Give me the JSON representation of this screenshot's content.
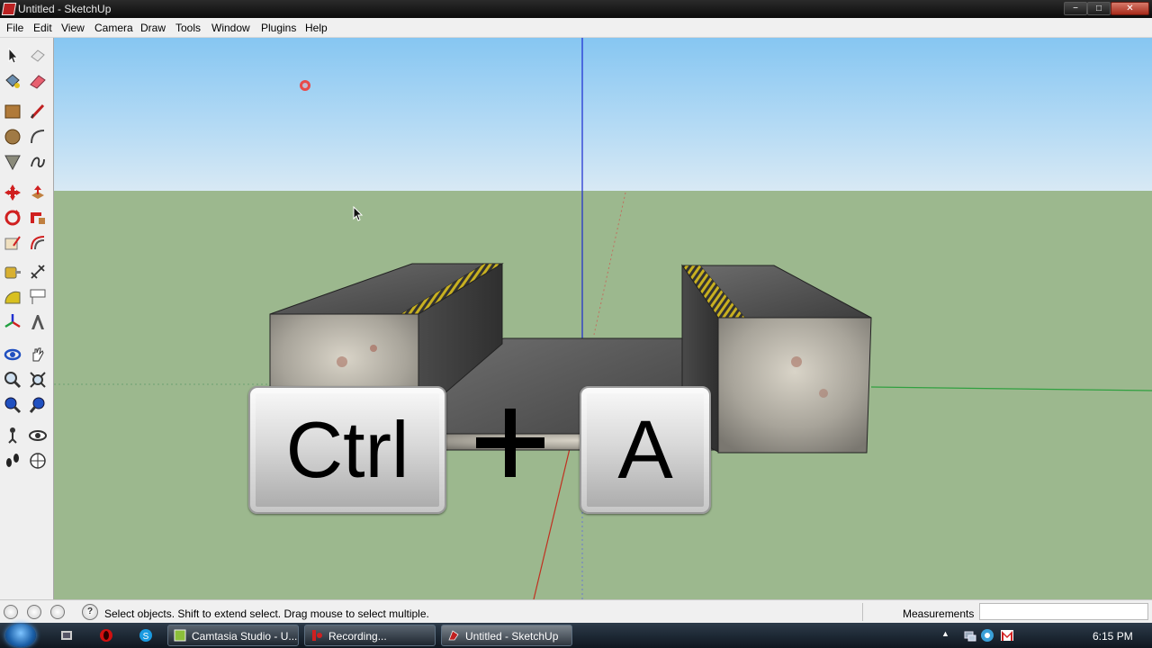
{
  "window": {
    "title": "Untitled - SketchUp",
    "controls": {
      "minimize": "−",
      "maximize": "□",
      "close": "✕"
    }
  },
  "menu": [
    "File",
    "Edit",
    "View",
    "Camera",
    "Draw",
    "Tools",
    "Window",
    "Plugins",
    "Help"
  ],
  "toolbar": {
    "tools": [
      "select-icon",
      "make-component-icon",
      "paint-bucket-icon",
      "eraser-icon",
      "rectangle-icon",
      "line-icon",
      "circle-icon",
      "arc-icon",
      "polygon-icon",
      "freehand-icon",
      "move-icon",
      "push-pull-icon",
      "rotate-icon",
      "follow-me-icon",
      "scale-icon",
      "offset-icon",
      "tape-measure-icon",
      "dimension-icon",
      "protractor-icon",
      "text-icon",
      "axes-icon",
      "3d-text-icon",
      "orbit-icon",
      "pan-icon",
      "zoom-icon",
      "zoom-extents-icon",
      "previous-view-icon",
      "next-view-icon",
      "position-camera-icon",
      "look-around-icon",
      "walk-icon",
      "section-plane-icon"
    ]
  },
  "overlay": {
    "key1": "Ctrl",
    "key2": "A"
  },
  "status": {
    "help_icon": "?",
    "text": "Select objects. Shift to extend select. Drag mouse to select multiple.",
    "measurements_label": "Measurements",
    "measurements_value": ""
  },
  "taskbar": {
    "items": [
      {
        "label": "Camtasia Studio - U...",
        "icon": "camtasia-icon"
      },
      {
        "label": "Recording...",
        "icon": "recording-icon"
      },
      {
        "label": "Untitled - SketchUp",
        "icon": "sketchup-icon"
      }
    ],
    "tray_arrow": "▲",
    "clock": "6:15 PM"
  },
  "colors": {
    "sky_top": "#86c6f2",
    "ground": "#9cb88e",
    "axis_blue": "#1a2ad0",
    "axis_red": "#c03020",
    "axis_green": "#30a040"
  }
}
